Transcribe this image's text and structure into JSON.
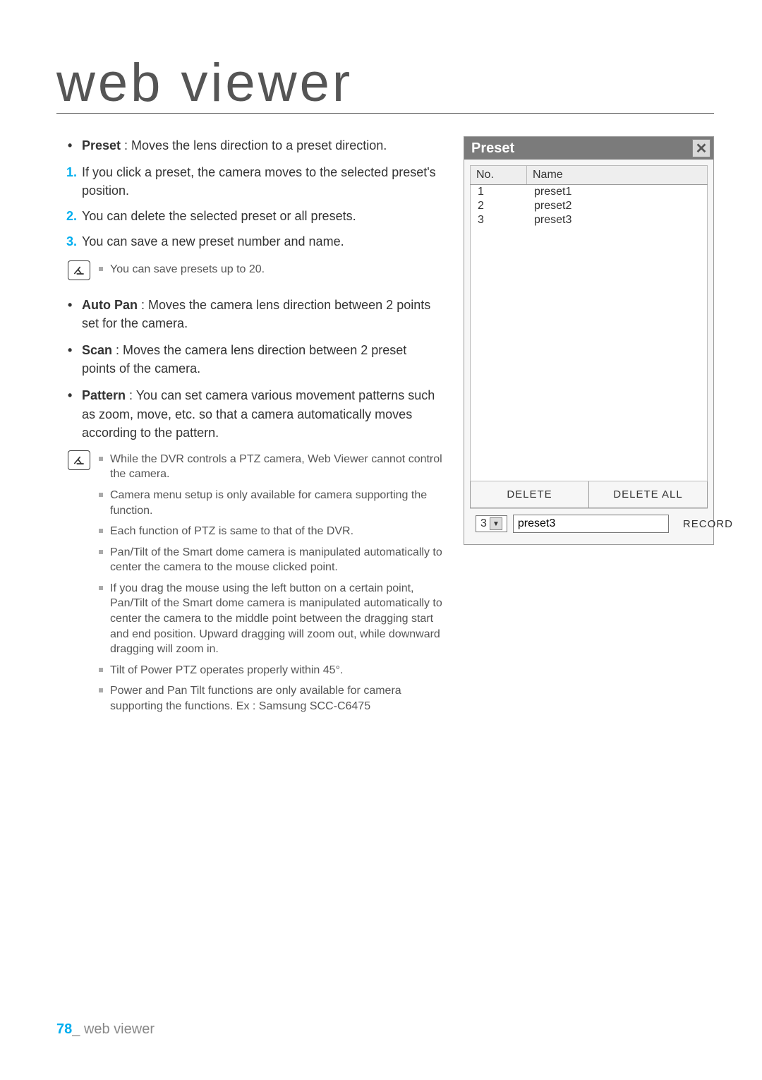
{
  "title": "web viewer",
  "bullets1": [
    {
      "term": "Preset",
      "desc": " : Moves the lens direction to a preset direction."
    }
  ],
  "steps": [
    "If you click a preset, the camera moves to the selected preset's position.",
    "You can delete the selected preset or all presets.",
    "You can save a new preset number and name."
  ],
  "note1": [
    "You can save presets up to 20."
  ],
  "bullets2": [
    {
      "term": "Auto Pan",
      "desc": " : Moves the camera lens direction between 2 points set for the camera."
    },
    {
      "term": "Scan",
      "desc": " : Moves the camera lens direction between 2 preset points of the camera."
    },
    {
      "term": "Pattern",
      "desc": " : You can set camera various movement patterns such as zoom, move, etc. so that a camera automatically moves according to the pattern."
    }
  ],
  "note2": [
    "While the DVR controls a PTZ camera, Web Viewer cannot control the camera.",
    "Camera menu setup is only available for camera supporting the function.",
    "Each function of PTZ is same to that of the DVR.",
    "Pan/Tilt of the Smart dome camera is manipulated automatically to center the camera to the mouse clicked point.",
    "If you drag the mouse using the left button on a certain point, Pan/Tilt of the Smart dome camera is manipulated automatically to center the camera to the middle point between the dragging start and end position. Upward dragging will zoom out, while downward dragging will zoom in.",
    "Tilt of Power PTZ operates properly within 45°.",
    "Power and Pan Tilt functions are only available for camera supporting the functions. Ex : Samsung SCC-C6475"
  ],
  "preset_panel": {
    "title": "Preset",
    "col_no": "No.",
    "col_name": "Name",
    "rows": [
      {
        "no": "1",
        "name": "preset1"
      },
      {
        "no": "2",
        "name": "preset2"
      },
      {
        "no": "3",
        "name": "preset3"
      }
    ],
    "delete": "DELETE",
    "delete_all": "DELETE ALL",
    "dropdown_value": "3",
    "name_value": "preset3",
    "record": "RECORD"
  },
  "footer": {
    "page": "78",
    "section": "web viewer",
    "sep": "_ "
  }
}
